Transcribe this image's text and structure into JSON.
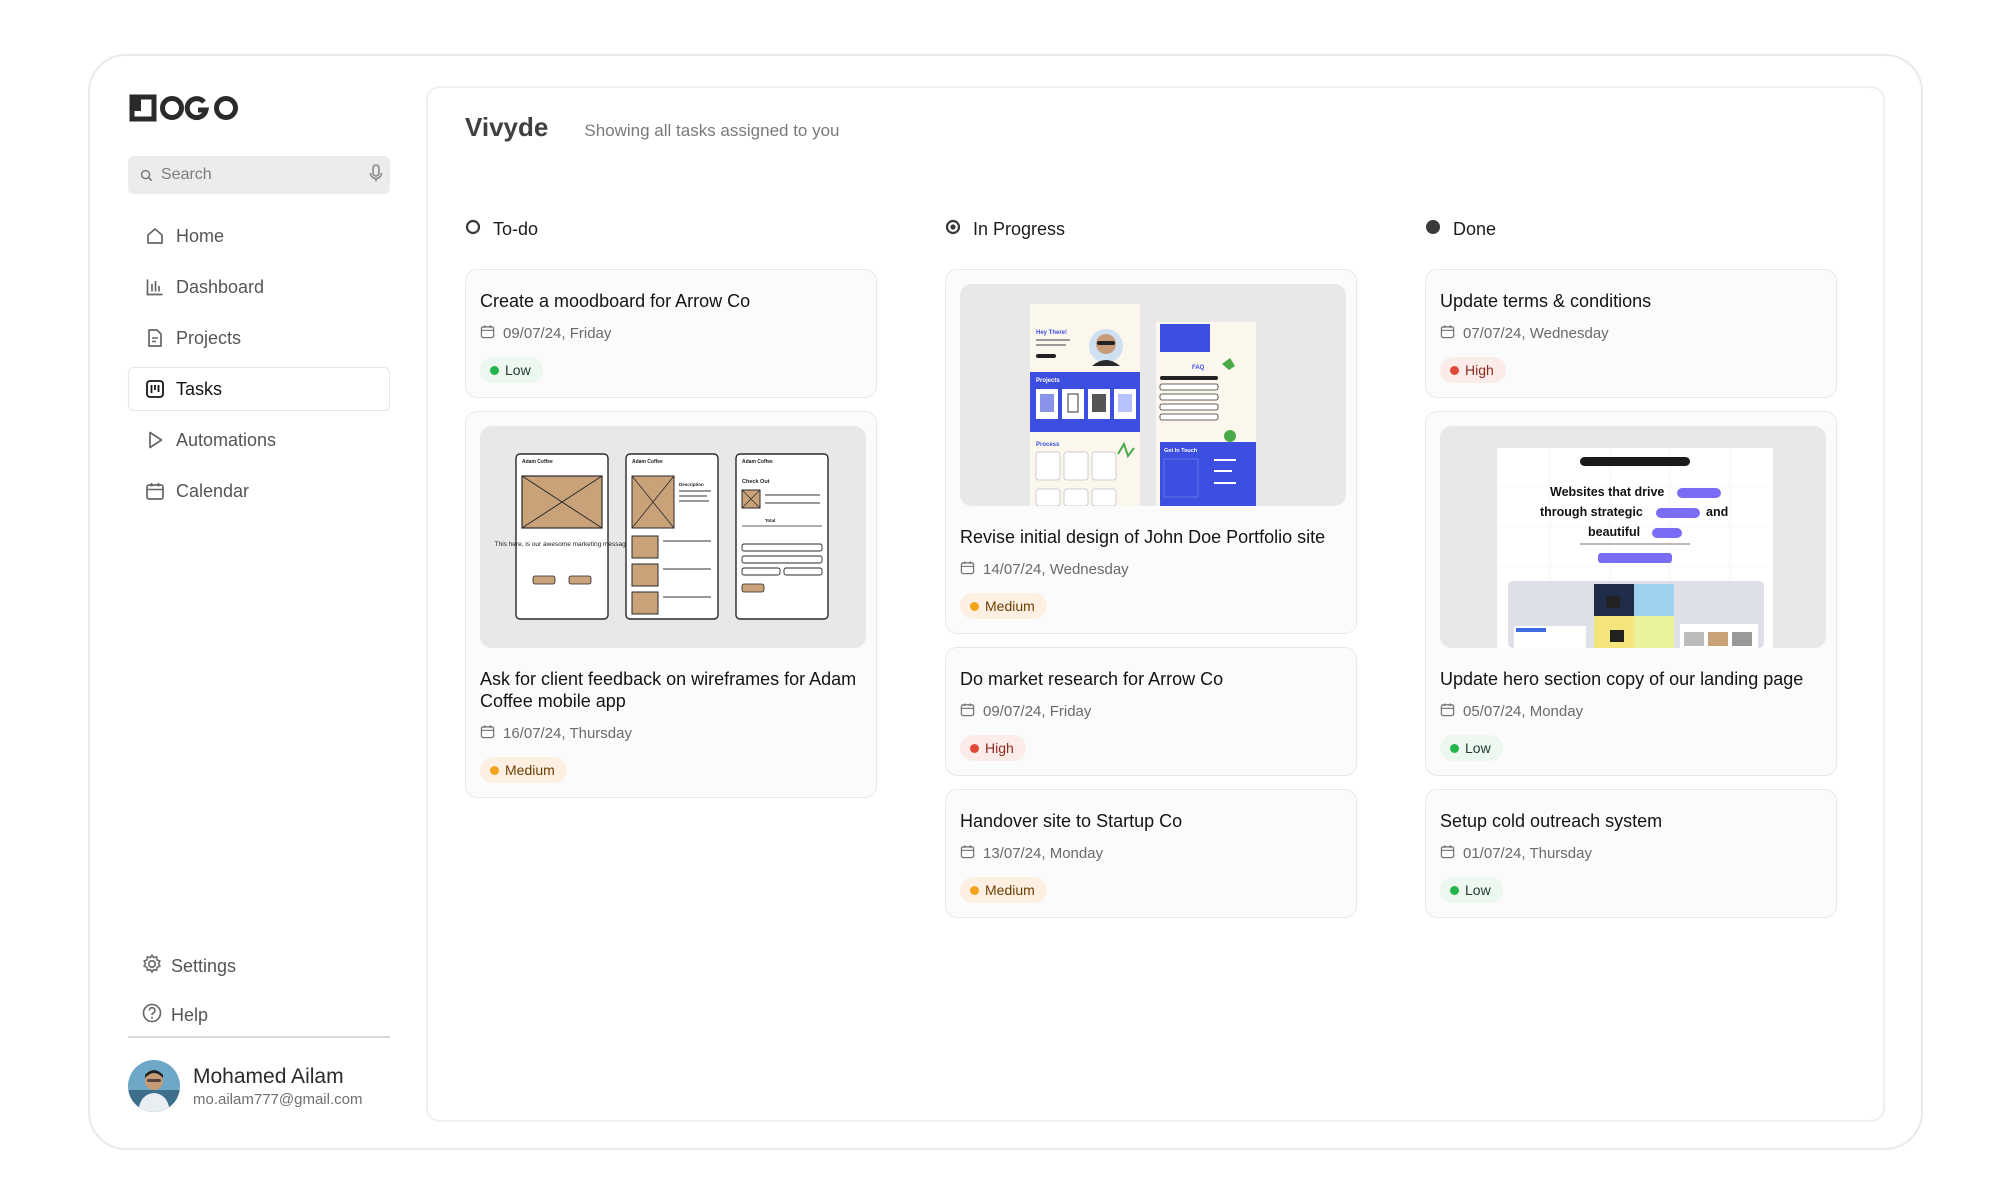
{
  "brand": {
    "logo_text": "LOGO"
  },
  "search": {
    "placeholder": "Search"
  },
  "sidebar": {
    "items": [
      {
        "label": "Home",
        "icon": "home-icon"
      },
      {
        "label": "Dashboard",
        "icon": "bar-chart-icon"
      },
      {
        "label": "Projects",
        "icon": "document-icon"
      },
      {
        "label": "Tasks",
        "icon": "tasks-icon",
        "active": true
      },
      {
        "label": "Automations",
        "icon": "play-icon"
      },
      {
        "label": "Calendar",
        "icon": "calendar-icon"
      }
    ],
    "settings_label": "Settings",
    "help_label": "Help"
  },
  "user": {
    "name": "Mohamed Ailam",
    "email": "mo.ailam777@gmail.com"
  },
  "header": {
    "title": "Vivyde",
    "subtitle": "Showing all tasks assigned to you"
  },
  "columns": [
    {
      "label": "To-do",
      "status_icon": "circle-outline-icon",
      "cards": [
        {
          "title": "Create a moodboard for Arrow Co",
          "date": "09/07/24, Friday",
          "priority": "Low"
        },
        {
          "title": "Ask for client feedback on wireframes for Adam Coffee mobile app",
          "date": "16/07/24, Thursday",
          "priority": "Medium",
          "thumbnail": "wireframe-screens"
        }
      ]
    },
    {
      "label": "In Progress",
      "status_icon": "circle-in-progress-icon",
      "cards": [
        {
          "title": "Revise initial design of John Doe Portfolio site",
          "date": "14/07/24, Wednesday",
          "priority": "Medium",
          "thumbnail": "portfolio-mockup"
        },
        {
          "title": "Do market research for Arrow Co",
          "date": "09/07/24, Friday",
          "priority": "High"
        },
        {
          "title": "Handover site to Startup Co",
          "date": "13/07/24, Monday",
          "priority": "Medium"
        }
      ]
    },
    {
      "label": "Done",
      "status_icon": "circle-filled-icon",
      "cards": [
        {
          "title": "Update terms & conditions",
          "date": "07/07/24, Wednesday",
          "priority": "High"
        },
        {
          "title": "Update hero section copy of our landing page",
          "date": "05/07/24, Monday",
          "priority": "Low",
          "thumbnail": "landing-page-mockup"
        },
        {
          "title": "Setup cold outreach system",
          "date": "01/07/24, Thursday",
          "priority": "Low"
        }
      ]
    }
  ],
  "thumbnails": {
    "landing_headline_1": "Websites that drive",
    "landing_headline_2": "through strategic",
    "landing_headline_3": "beautiful",
    "landing_word_and": "and",
    "portfolio_hey": "Hey There!",
    "portfolio_projects": "Projects",
    "portfolio_process": "Process",
    "portfolio_faq": "FAQ",
    "portfolio_contact": "Get In Touch",
    "wireframe_brand": "Adam Coffee",
    "wireframe_message": "This here, is our awesome marketing message",
    "wireframe_checkout": "Check Out",
    "wireframe_description": "Description",
    "wireframe_total": "Total"
  },
  "colors": {
    "low": "#22b54b",
    "medium": "#f1a31c",
    "high": "#e0493a",
    "accent": "#3d4fe0"
  }
}
